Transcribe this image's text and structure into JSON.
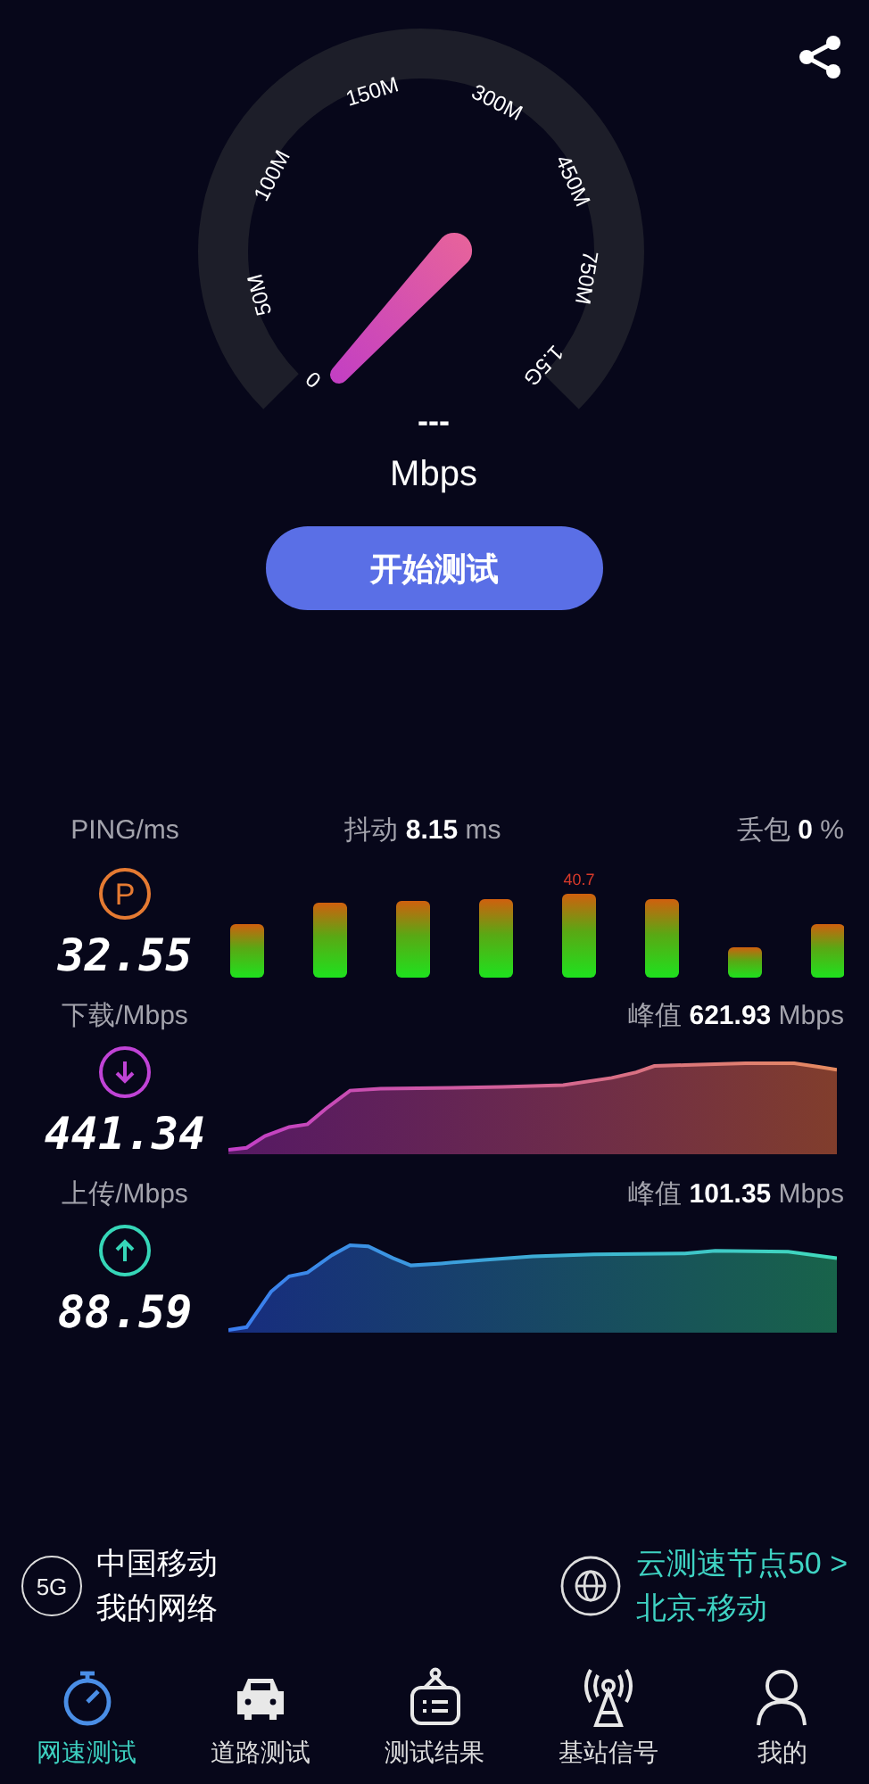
{
  "gauge": {
    "ticks": [
      "0",
      "50M",
      "100M",
      "150M",
      "300M",
      "450M",
      "750M",
      "1.5G"
    ],
    "value": "---",
    "unit": "Mbps"
  },
  "start_button": "开始测试",
  "ping": {
    "label": "PING/ms",
    "badge": "P",
    "value": "32.55",
    "peak_label": "40.7"
  },
  "jitter": "抖动 **8.15** ms",
  "loss": "丢包 **0** %",
  "download": {
    "label": "下载/Mbps",
    "value": "441.34",
    "peak": "峰值 **621.93** Mbps"
  },
  "upload": {
    "label": "上传/Mbps",
    "value": "88.59",
    "peak": "峰值 **101.35** Mbps"
  },
  "network": {
    "badge": "5G",
    "operator": "中国移动",
    "name": "我的网络"
  },
  "server": {
    "title": "云测速节点50 >",
    "location": "北京-移动"
  },
  "tabs": [
    {
      "label": "网速测试",
      "selected": true
    },
    {
      "label": "道路测试",
      "selected": false
    },
    {
      "label": "测试结果",
      "selected": false
    },
    {
      "label": "基站信号",
      "selected": false
    },
    {
      "label": "我的",
      "selected": false
    }
  ]
}
